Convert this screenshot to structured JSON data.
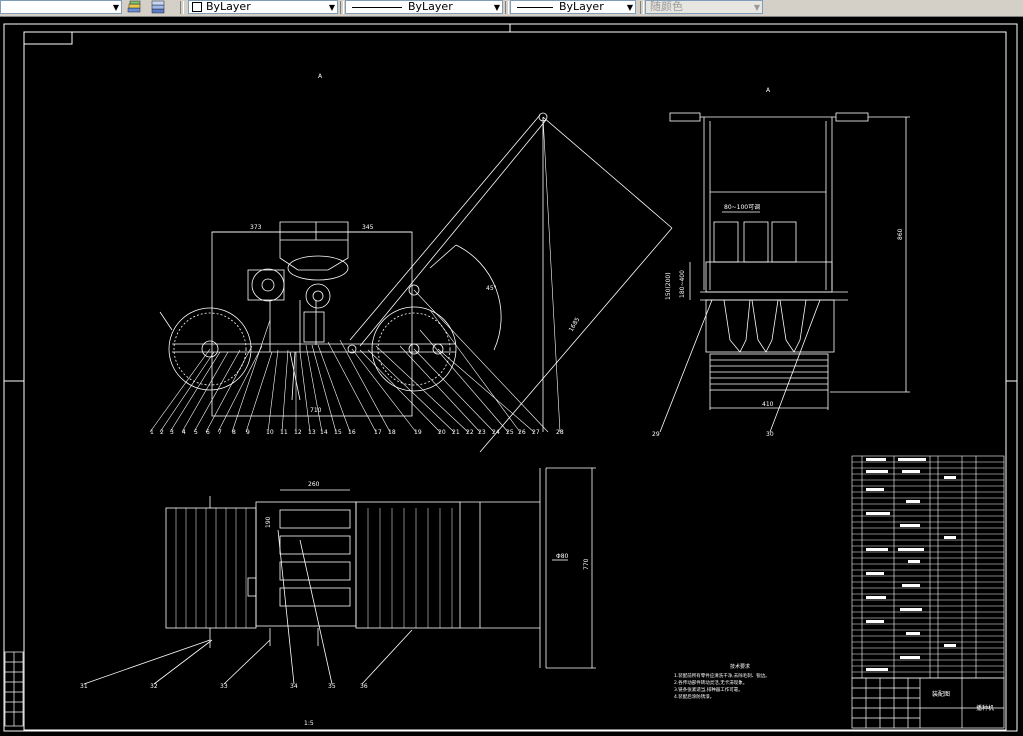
{
  "toolbar": {
    "layer_icon_1": "layer-states-icon",
    "layer_icon_2": "layer-previous-icon",
    "color_value": "ByLayer",
    "linetype_value": "ByLayer",
    "lineweight_value": "ByLayer",
    "plotstyle_value": "随颜色"
  },
  "drawing": {
    "side_dims": [
      "373",
      "345",
      "710",
      "1685"
    ],
    "side_angle": "45°",
    "side_labels": [
      "1",
      "2",
      "3",
      "4",
      "5",
      "6",
      "7",
      "8",
      "9",
      "10",
      "11",
      "12",
      "13",
      "14",
      "15",
      "16",
      "17",
      "18",
      "19",
      "20",
      "21",
      "22",
      "23",
      "24",
      "25",
      "26",
      "27",
      "28"
    ],
    "front_dims": [
      "410",
      "860",
      "150(200)",
      "180~400",
      "80~100可调"
    ],
    "front_labels": [
      "29",
      "30"
    ],
    "plan_dims": [
      "260",
      "190",
      "Φ80",
      "770"
    ],
    "plan_labels": [
      "31",
      "32",
      "33",
      "34",
      "35",
      "36"
    ],
    "view_marks": [
      "A",
      "A"
    ],
    "scale_note": "1:5",
    "tech_title": "技术要求",
    "tech_lines": [
      "1.装配前所有零件应清洗干净,去除毛刺、锐边。",
      "2.各传动部件转动灵活,无卡滞现象。",
      "3.链条张紧适当,排种器工作可靠。",
      "4.装配后涂防锈漆。"
    ],
    "title_company": "装配图",
    "title_name": "播种机"
  },
  "colors": {
    "background": "#000000",
    "lines": "#ffffff",
    "toolbar_bg": "#d4d0c8"
  }
}
